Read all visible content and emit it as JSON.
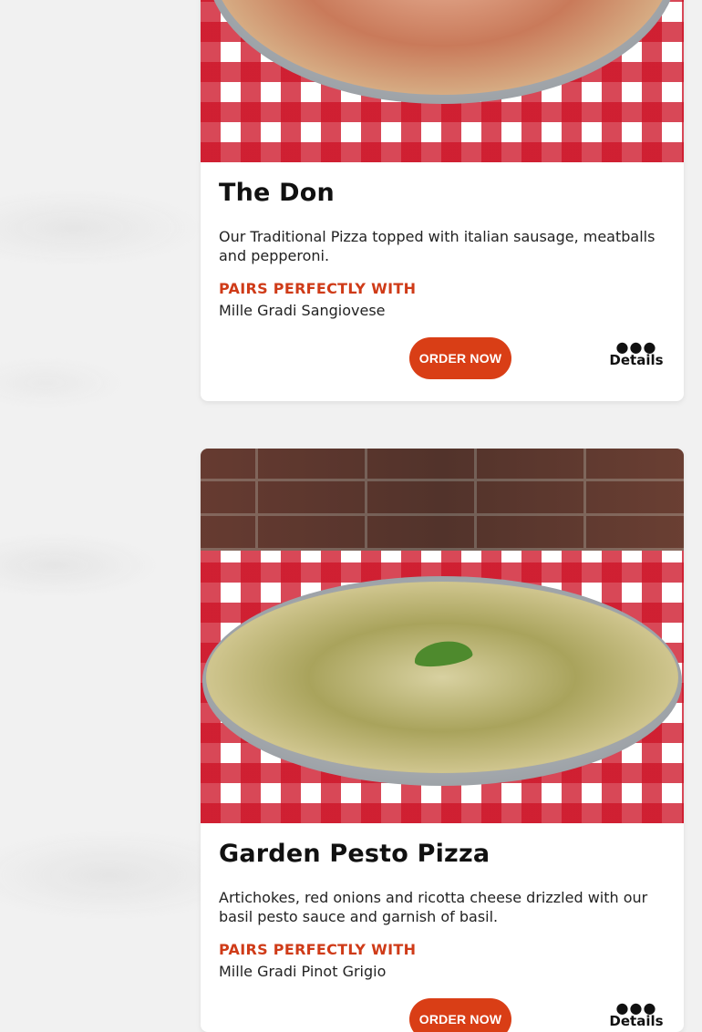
{
  "items": [
    {
      "title": "The Don",
      "description": "Our Traditional Pizza topped with italian sausage, meatballs and pepperoni.",
      "pairs_heading": "PAIRS PERFECTLY WITH",
      "pairs_value": "Mille Gradi Sangiovese",
      "order_label": "ORDER NOW",
      "details_label": "Details",
      "details_icon": "more-dots-icon"
    },
    {
      "title": "Garden Pesto Pizza",
      "description": "Artichokes, red onions and ricotta cheese drizzled with our basil pesto sauce and garnish of basil.",
      "pairs_heading": "PAIRS PERFECTLY WITH",
      "pairs_value": "Mille Gradi Pinot Grigio",
      "order_label": "ORDER NOW",
      "details_label": "Details",
      "details_icon": "more-dots-icon"
    }
  ],
  "colors": {
    "accent": "#d93e16",
    "pairs_heading": "#cf3b18"
  }
}
